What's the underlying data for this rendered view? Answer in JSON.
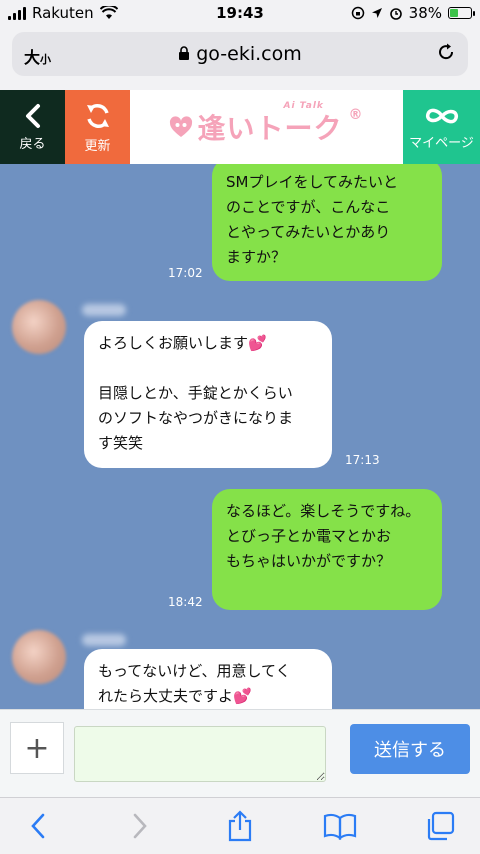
{
  "status": {
    "carrier": "Rakuten",
    "time": "19:43",
    "battery": "38%",
    "battery_level": 0.38
  },
  "browser": {
    "aa_big": "大",
    "aa_small": "小",
    "url": "go-eki.com"
  },
  "nav": {
    "back_label": "戻る",
    "reload_label": "更新",
    "logo_text": "逢いトーク",
    "logo_sub": "Ai Talk",
    "logo_mark": "®",
    "mypage_label": "マイページ"
  },
  "messages": [
    {
      "side": "me",
      "text": "SMプレイをしてみたいと\nのことですが、こんなこ\nとやってみたいとかあり\nますか？",
      "time": "17:02"
    },
    {
      "side": "them",
      "text": "よろしくお願いします💕\n\n目隠しとか、手錠とかくらい\nのソフトなやつがきになりま\nす笑笑",
      "time": "17:13"
    },
    {
      "side": "me",
      "text": "なるほど。楽しそうですね。\nとびっ子とか電マとかお\nもちゃはいかがですか？",
      "time": "18:42"
    },
    {
      "side": "them",
      "text": "もってないけど、用意してく\nれたら大丈夫ですよ💕",
      "time": ""
    }
  ],
  "input": {
    "plus": "+",
    "placeholder": "",
    "send_label": "送信する"
  },
  "toolbar": {
    "icons": [
      "back-icon",
      "forward-icon",
      "share-icon",
      "bookmarks-icon",
      "tabs-icon"
    ]
  },
  "colors": {
    "chat_bg": "#6f91c1",
    "my_bubble": "#85e149",
    "their_bubble": "#ffffff",
    "send_button": "#4d8ee6",
    "mypage": "#1fc58f",
    "reload": "#f06a3d",
    "back": "#0f2a1f"
  }
}
